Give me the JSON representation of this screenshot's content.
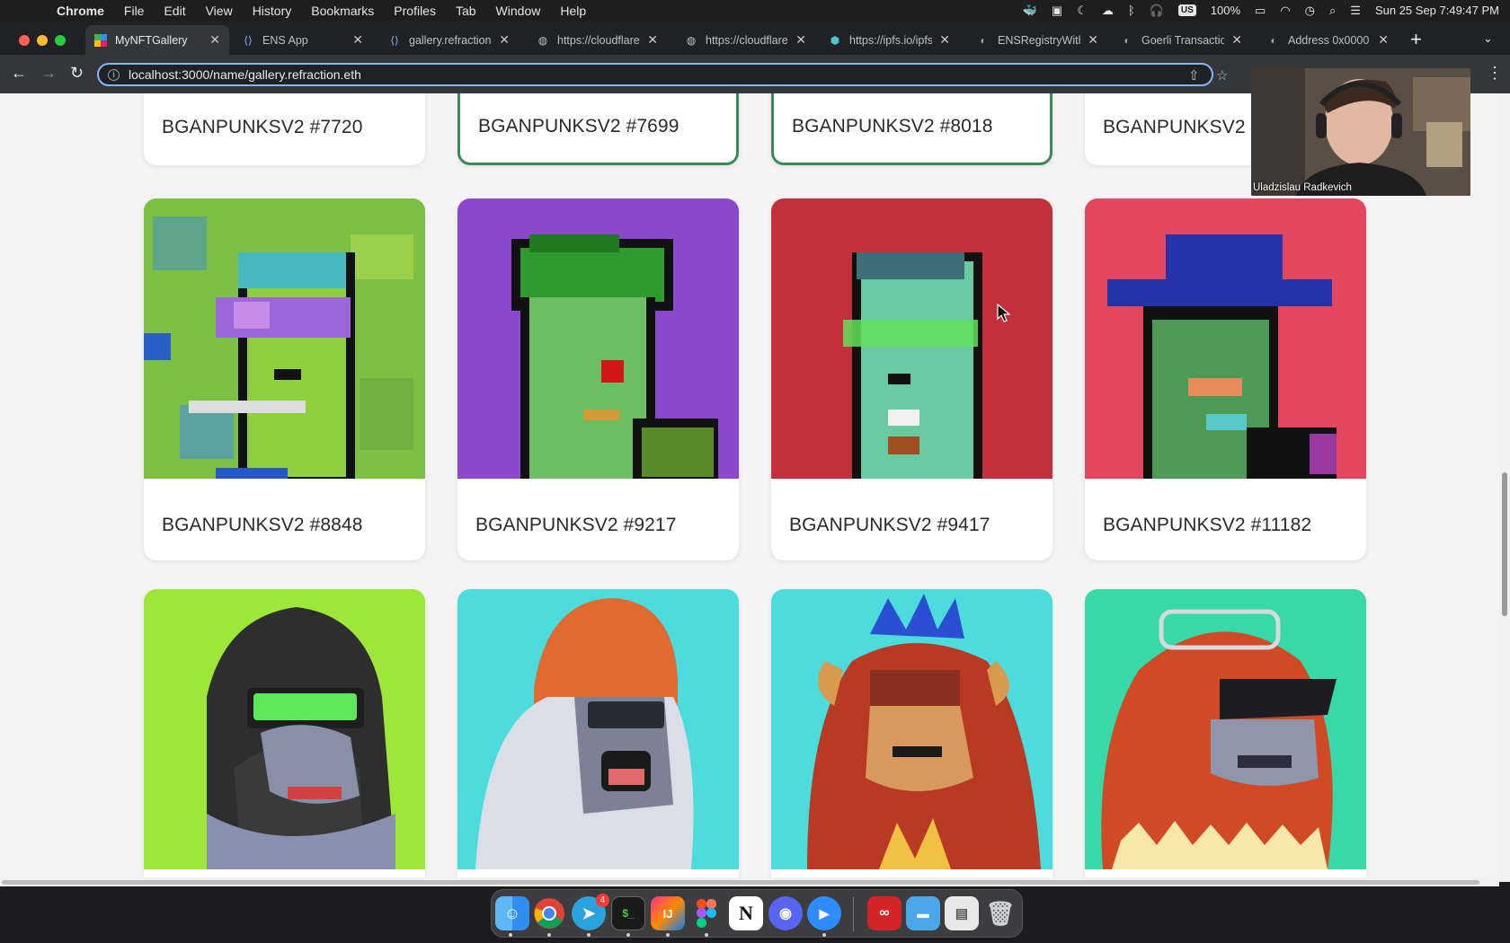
{
  "menubar": {
    "app": "Chrome",
    "items": [
      "File",
      "Edit",
      "View",
      "History",
      "Bookmarks",
      "Profiles",
      "Tab",
      "Window",
      "Help"
    ],
    "battery": "100%",
    "datetime": "Sun 25 Sep  7:49:47 PM",
    "input_badge": "US"
  },
  "tabs": [
    {
      "title": "MyNFTGallery",
      "active": true
    },
    {
      "title": "ENS App",
      "active": false
    },
    {
      "title": "gallery.refraction.",
      "active": false
    },
    {
      "title": "https://cloudflare",
      "active": false
    },
    {
      "title": "https://cloudflare",
      "active": false
    },
    {
      "title": "https://ipfs.io/ipfs",
      "active": false
    },
    {
      "title": "ENSRegistryWith",
      "active": false
    },
    {
      "title": "Goerli Transaction",
      "active": false
    },
    {
      "title": "Address 0x0000",
      "active": false
    }
  ],
  "address_bar": {
    "url": "localhost:3000/name/gallery.refraction.eth"
  },
  "gallery": {
    "row1": [
      {
        "label": "BGANPUNKSV2 #7720",
        "selected": false
      },
      {
        "label": "BGANPUNKSV2 #7699",
        "selected": true
      },
      {
        "label": "BGANPUNKSV2 #8018",
        "selected": true
      },
      {
        "label": "BGANPUNKSV2 #",
        "selected": false
      }
    ],
    "row2": [
      {
        "label": "BGANPUNKSV2 #8848",
        "bg": "#7fbf3a"
      },
      {
        "label": "BGANPUNKSV2 #9217",
        "bg": "#8d4ad0"
      },
      {
        "label": "BGANPUNKSV2 #9417",
        "bg": "#c5323c"
      },
      {
        "label": "BGANPUNKSV2 #11182",
        "bg": "#e6455e"
      }
    ],
    "row3": [
      {
        "bg": "#9ee637"
      },
      {
        "bg": "#4ddcde"
      },
      {
        "bg": "#4ddcde"
      },
      {
        "bg": "#37d9a8"
      }
    ]
  },
  "webcam": {
    "participant": "Uladzislau Radkevich"
  },
  "dock": {
    "telegram_badge": "4",
    "apps": [
      "Finder",
      "Chrome",
      "Telegram",
      "Terminal",
      "IntelliJ IDEA",
      "Figma",
      "Notion",
      "Discord",
      "Zoom",
      "Acrobat",
      "Folder",
      "Preview",
      "Trash"
    ]
  },
  "colors": {
    "selected_border": "#3a8a57",
    "page_bg": "#f4f4f4",
    "omnibox_focus": "#8ab4f8"
  }
}
